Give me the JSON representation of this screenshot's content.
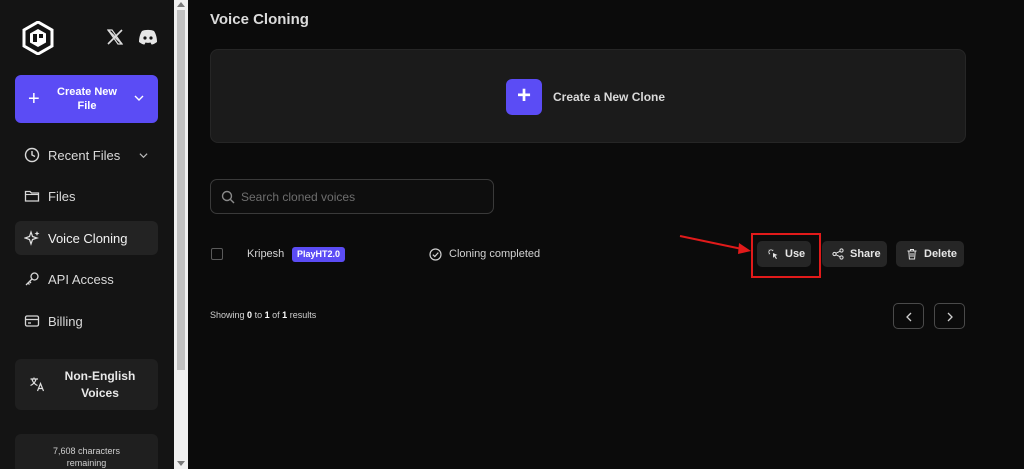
{
  "sidebar": {
    "create_button_label": "Create New File",
    "nav": [
      {
        "label": "Recent Files",
        "icon": "clock-icon"
      },
      {
        "label": "Files",
        "icon": "folder-icon"
      },
      {
        "label": "Voice Cloning",
        "icon": "sparkles-icon"
      },
      {
        "label": "API Access",
        "icon": "key-icon"
      },
      {
        "label": "Billing",
        "icon": "card-icon"
      }
    ],
    "non_english_label": "Non-English Voices",
    "characters_count": "7,608 characters",
    "characters_suffix": "remaining"
  },
  "main": {
    "title": "Voice Cloning",
    "create_clone_label": "Create a New Clone",
    "search_placeholder": "Search cloned voices",
    "rows": [
      {
        "name": "Kripesh",
        "badge": "PlayHT2.0",
        "status": "Cloning completed",
        "actions": {
          "use": "Use",
          "share": "Share",
          "delete": "Delete"
        }
      }
    ],
    "results": {
      "prefix": "Showing",
      "from": "0",
      "to_word": "to",
      "to": "1",
      "of_word": "of",
      "total": "1",
      "suffix": "results"
    }
  },
  "colors": {
    "accent": "#5b4cf5",
    "highlight": "#e11a1a",
    "background": "#0b0b0b"
  }
}
